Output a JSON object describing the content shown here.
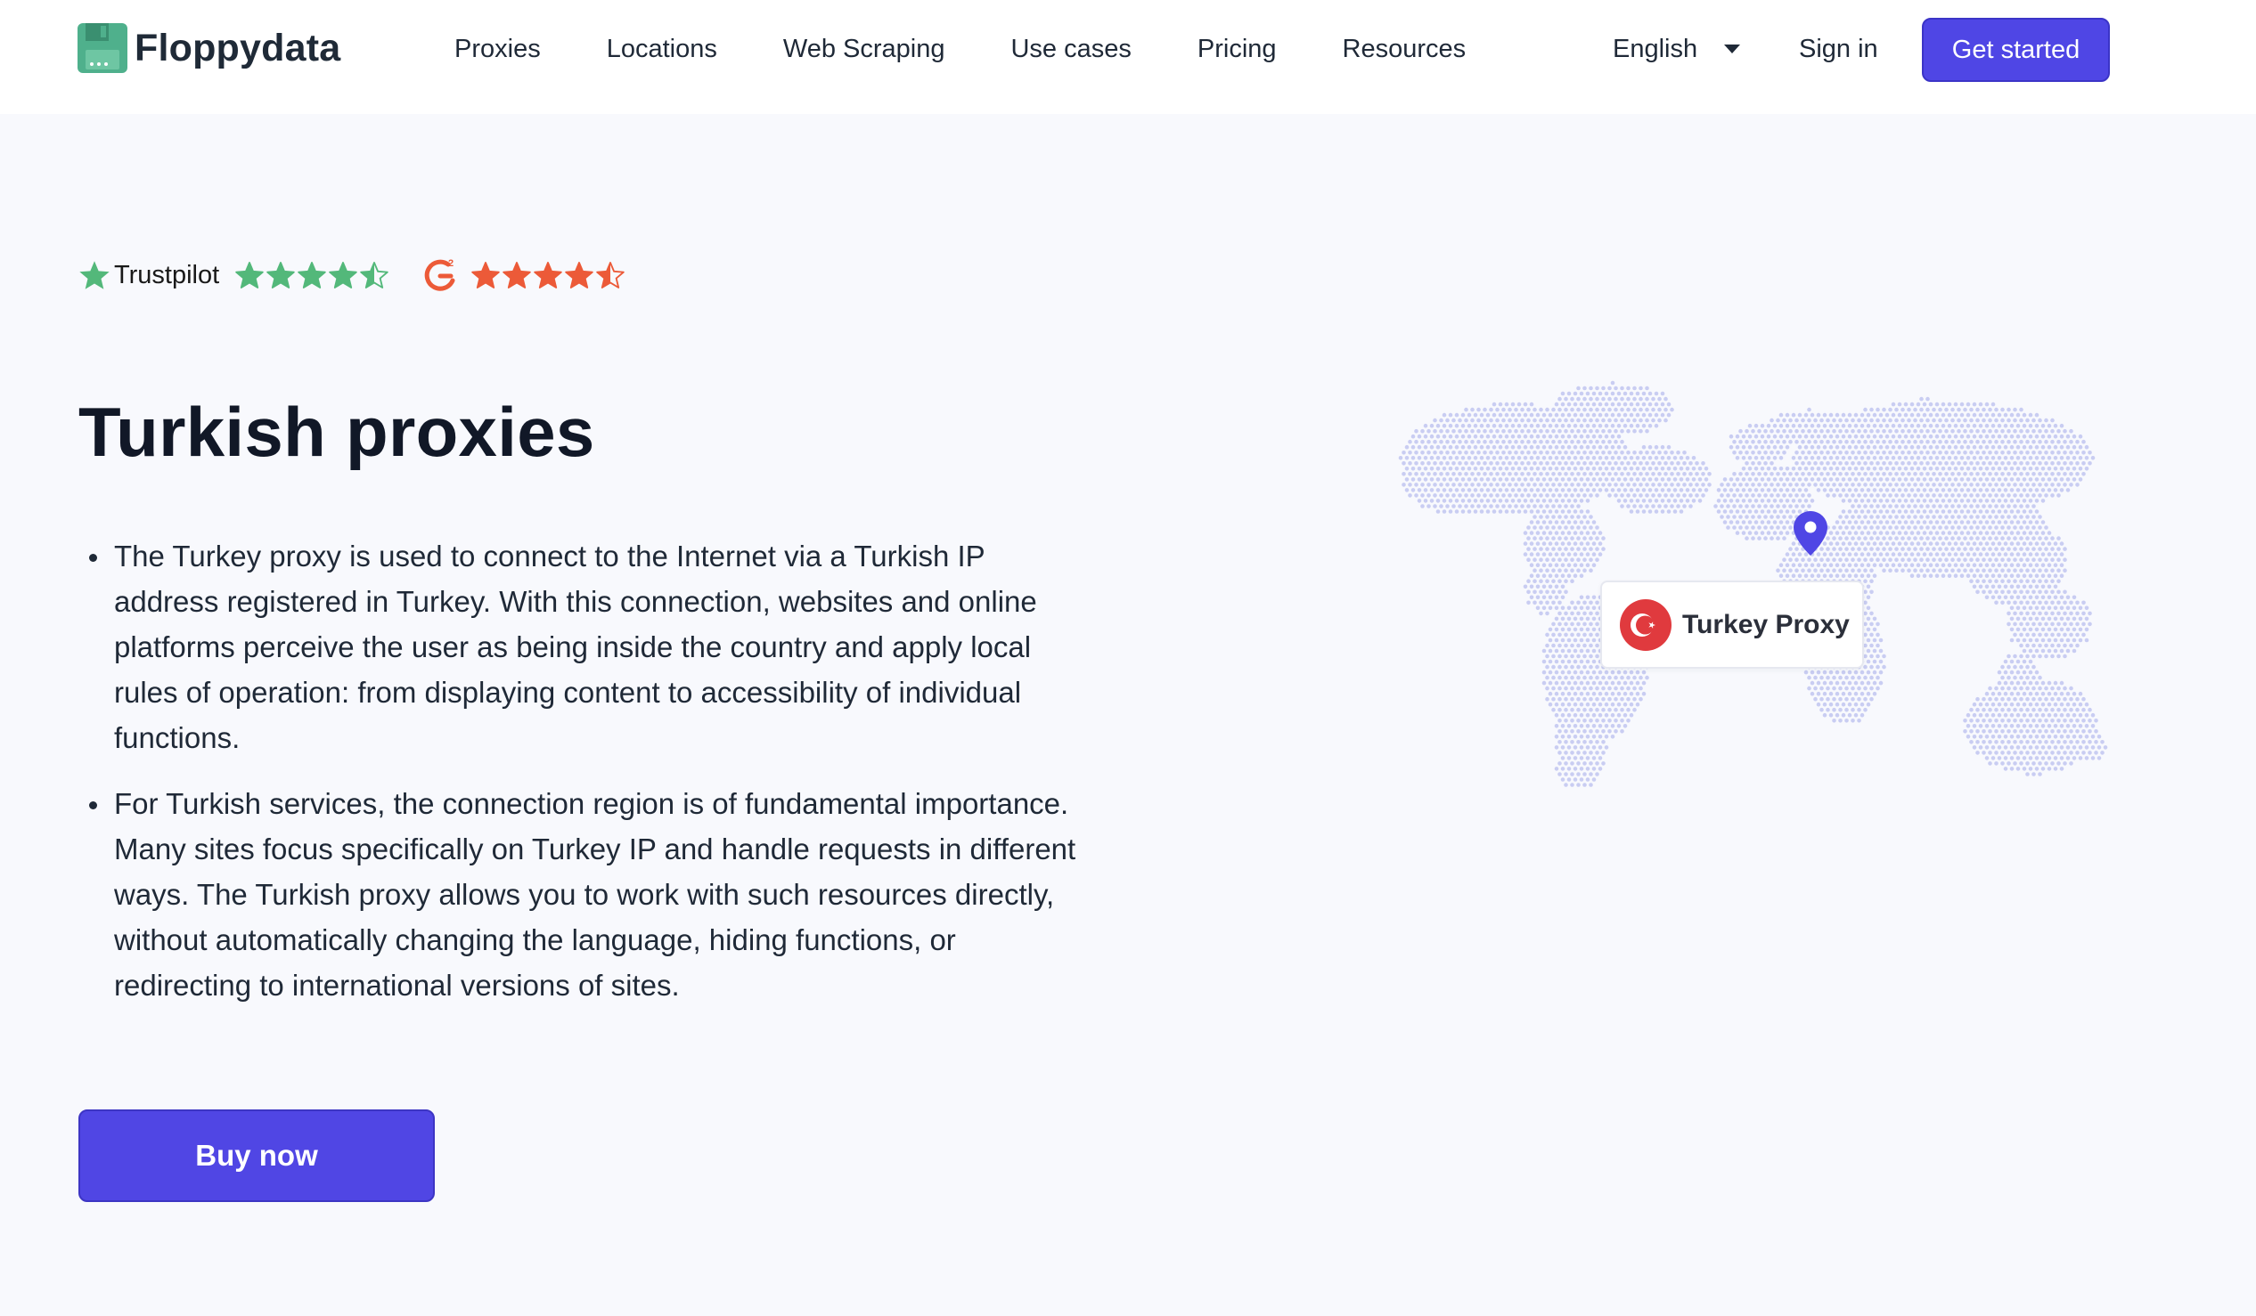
{
  "brand": {
    "name": "Floppydata"
  },
  "nav": {
    "items": [
      {
        "label": "Proxies"
      },
      {
        "label": "Locations"
      },
      {
        "label": "Web Scraping"
      },
      {
        "label": "Use cases"
      },
      {
        "label": "Pricing"
      },
      {
        "label": "Resources"
      }
    ],
    "language": "English",
    "signin": "Sign in",
    "cta": "Get started"
  },
  "ratings": {
    "trustpilot": {
      "label": "Trustpilot",
      "stars": 4.5,
      "color": "#53b87a"
    },
    "g2": {
      "stars": 4.5,
      "color": "#ec5a38"
    }
  },
  "hero": {
    "title": "Turkish proxies",
    "bullets": [
      "The Turkey proxy is used to connect to the Internet via a Turkish IP address registered in Turkey. With this connection, websites and online platforms perceive the user as being inside the country and apply local rules of operation: from displaying content to accessibility of individual functions.",
      "For Turkish services, the connection region is of fundamental importance. Many sites focus specifically on Turkey IP and handle requests in different ways. The Turkish proxy allows you to work with such resources directly, without automatically changing the language, hiding functions, or redirecting to international versions of sites."
    ],
    "buy_label": "Buy now"
  },
  "map": {
    "label": "Turkey Proxy",
    "dot_color": "#c9cdf2",
    "pin_color": "#4f46e5",
    "flag_color": "#e03a3e"
  },
  "colors": {
    "accent": "#4f46e5",
    "background": "#f8f9fd"
  },
  "icons": {
    "logo": "floppy-disk-icon",
    "caret": "caret-down-icon",
    "pin": "location-pin-icon",
    "flag": "turkey-flag-icon"
  }
}
